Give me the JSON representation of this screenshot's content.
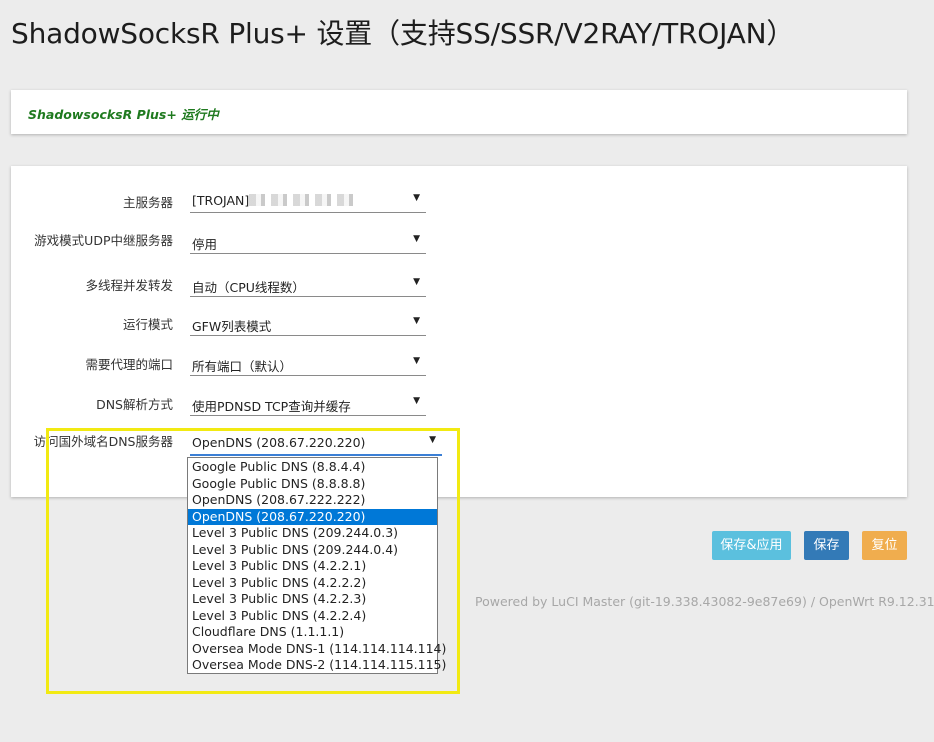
{
  "page": {
    "title": "ShadowSocksR Plus+ 设置（支持SS/SSR/V2RAY/TROJAN）",
    "status": "ShadowsocksR Plus+ 运行中"
  },
  "form": {
    "fields": [
      {
        "label": "主服务器",
        "value": "[TROJAN]"
      },
      {
        "label": "游戏模式UDP中继服务器",
        "value": "停用"
      },
      {
        "label": "多线程并发转发",
        "value": "自动（CPU线程数）"
      },
      {
        "label": "运行模式",
        "value": "GFW列表模式"
      },
      {
        "label": "需要代理的端口",
        "value": "所有端口（默认）"
      },
      {
        "label": "DNS解析方式",
        "value": "使用PDNSD TCP查询并缓存"
      },
      {
        "label": "访问国外域名DNS服务器",
        "value": "OpenDNS (208.67.220.220)"
      }
    ]
  },
  "dropdown": {
    "options": [
      "Google Public DNS (8.8.4.4)",
      "Google Public DNS (8.8.8.8)",
      "OpenDNS (208.67.222.222)",
      "OpenDNS (208.67.220.220)",
      "Level 3 Public DNS (209.244.0.3)",
      "Level 3 Public DNS (209.244.0.4)",
      "Level 3 Public DNS (4.2.2.1)",
      "Level 3 Public DNS (4.2.2.2)",
      "Level 3 Public DNS (4.2.2.3)",
      "Level 3 Public DNS (4.2.2.4)",
      "Cloudflare DNS (1.1.1.1)",
      "Oversea Mode DNS-1 (114.114.114.114)",
      "Oversea Mode DNS-2 (114.114.115.115)"
    ],
    "selected_index": 3
  },
  "buttons": {
    "save_apply": "保存&应用",
    "save": "保存",
    "reset": "复位"
  },
  "footer": "Powered by LuCI Master (git-19.338.43082-9e87e69) / OpenWrt R9.12.31",
  "colors": {
    "status_green": "#1f7a1f",
    "save_apply_bg": "#5bc0de",
    "save_bg": "#337ab7",
    "reset_bg": "#f0ad4e",
    "selection_blue": "#0078d7",
    "highlight_yellow": "#f2ea12"
  }
}
